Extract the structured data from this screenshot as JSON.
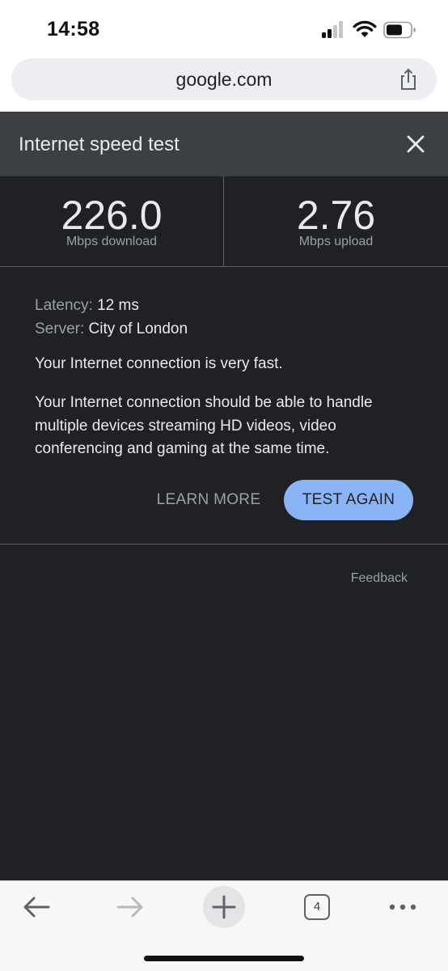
{
  "status_bar": {
    "time": "14:58",
    "icons": [
      "signal-icon",
      "wifi-icon",
      "battery-icon"
    ]
  },
  "url_bar": {
    "url": "google.com",
    "share_icon": "share-icon"
  },
  "speed_test": {
    "title": "Internet speed test",
    "close_icon": "close-icon",
    "download": {
      "value": "226.0",
      "unit": "Mbps download"
    },
    "upload": {
      "value": "2.76",
      "unit": "Mbps upload"
    },
    "latency_label": "Latency:",
    "latency_value": "12 ms",
    "server_label": "Server:",
    "server_value": "City of London",
    "summary": "Your Internet connection is very fast.",
    "description": "Your Internet connection should be able to handle multiple devices streaming HD videos, video conferencing and gaming at the same time.",
    "learn_more": "LEARN MORE",
    "test_again": "TEST AGAIN",
    "feedback": "Feedback"
  },
  "toolbar": {
    "back_icon": "back-arrow-icon",
    "forward_icon": "forward-arrow-icon",
    "new_tab_icon": "plus-icon",
    "tab_count": "4",
    "menu_icon": "more-icon"
  },
  "colors": {
    "background": "#202124",
    "header": "#3c4043",
    "accent": "#8ab4f8",
    "text": "#e8eaed",
    "muted": "#9aa0a6"
  }
}
